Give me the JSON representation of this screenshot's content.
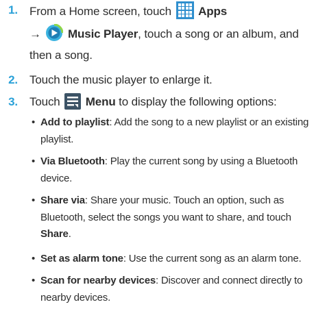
{
  "steps": [
    {
      "number": "1.",
      "text_a": "From a Home screen, touch",
      "apps_label": "Apps",
      "arrow": "→",
      "music_label": "Music Player",
      "text_b": ", touch a song or an album, and then a song."
    },
    {
      "number": "2.",
      "text": "Touch the music player to enlarge it."
    },
    {
      "number": "3.",
      "text_a": "Touch",
      "menu_label": "Menu",
      "text_b": "to display the following options:"
    }
  ],
  "options": [
    {
      "bullet": "•",
      "term": "Add to playlist",
      "desc": ": Add the song to a new playlist or an existing playlist."
    },
    {
      "bullet": "•",
      "term": "Via Bluetooth",
      "desc": ": Play the current song by using a Bluetooth device."
    },
    {
      "bullet": "•",
      "term": "Share via",
      "desc": ": Share your music. Touch an option, such as Bluetooth, select the songs you want to share, and touch ",
      "term2": "Share",
      "desc2": "."
    },
    {
      "bullet": "•",
      "term": "Set as alarm tone",
      "desc": ": Use the current song as an alarm tone."
    },
    {
      "bullet": "•",
      "term": "Scan for nearby devices",
      "desc": ": Discover and connect directly to nearby devices."
    }
  ],
  "icons": {
    "apps": "apps-grid-icon",
    "music": "music-player-icon",
    "menu": "menu-icon"
  },
  "colors": {
    "accent": "#2aa1d8",
    "apps_icon": "#2f8fce",
    "music_icon": "#3bb3e0",
    "menu_icon": "#3c5366",
    "text": "#2e2e2e"
  }
}
